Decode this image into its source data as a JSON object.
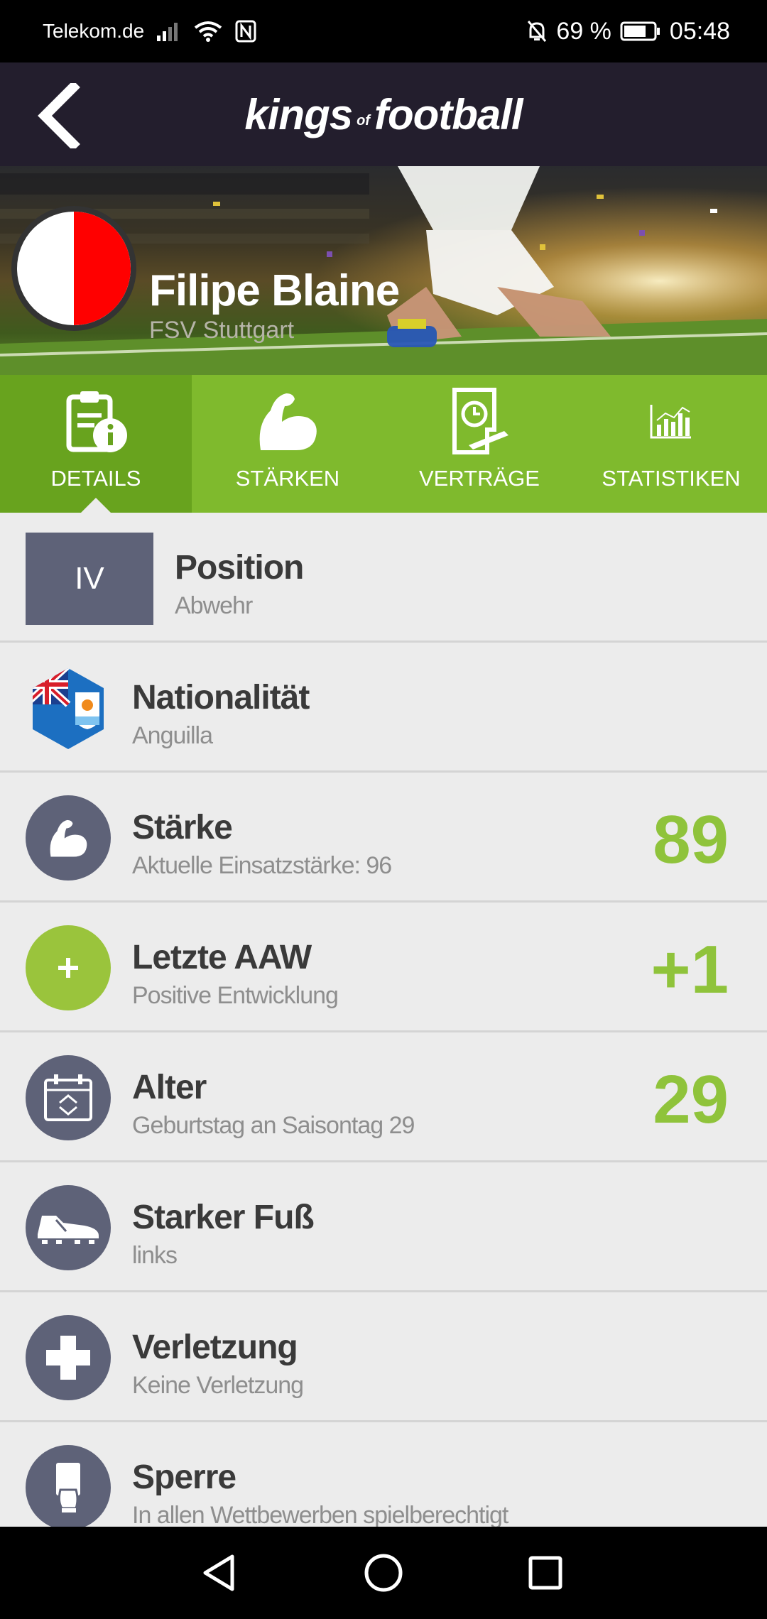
{
  "status_bar": {
    "carrier": "Telekom.de",
    "battery": "69 %",
    "time": "05:48",
    "icons": [
      "signal-icon",
      "wifi-icon",
      "nfc-icon",
      "mute-bell-icon",
      "battery-icon"
    ]
  },
  "app_bar": {
    "logo_part1": "kings",
    "logo_part2": "of",
    "logo_part3": "football",
    "back_icon": "chevron-left-icon"
  },
  "player": {
    "name": "Filipe Blaine",
    "club": "FSV Stuttgart",
    "club_colors": [
      "#ffffff",
      "#ff0000"
    ]
  },
  "tabs": [
    {
      "label": "DETAILS",
      "icon": "clipboard-info-icon",
      "active": true
    },
    {
      "label": "STÄRKEN",
      "icon": "flexed-arm-icon",
      "active": false
    },
    {
      "label": "VERTRÄGE",
      "icon": "contract-icon",
      "active": false
    },
    {
      "label": "STATISTIKEN",
      "icon": "bar-chart-icon",
      "active": false
    }
  ],
  "details": [
    {
      "title": "Position",
      "sub": "Abwehr",
      "badge": "IV"
    },
    {
      "title": "Nationalität",
      "sub": "Anguilla",
      "icon": "anguilla-flag-icon"
    },
    {
      "title": "Stärke",
      "sub": "Aktuelle Einsatzstärke: 96",
      "value": "89",
      "icon": "flexed-arm-icon"
    },
    {
      "title": "Letzte AAW",
      "sub": "Positive Entwicklung",
      "value": "+1",
      "icon": "plus-icon"
    },
    {
      "title": "Alter",
      "sub": "Geburtstag an Saisontag 29",
      "value": "29",
      "icon": "calendar-icon"
    },
    {
      "title": "Starker Fuß",
      "sub": "links",
      "icon": "football-boot-icon"
    },
    {
      "title": "Verletzung",
      "sub": "Keine Verletzung",
      "icon": "medical-cross-icon"
    },
    {
      "title": "Sperre",
      "sub": "In allen Wettbewerben spielberechtigt",
      "icon": "card-hand-icon"
    }
  ],
  "colors": {
    "app_bar": "#231e2d",
    "tab_green": "#7fba2d",
    "tab_active": "#68a31e",
    "value_green": "#8fc33b",
    "icon_circle": "#5e6278"
  }
}
